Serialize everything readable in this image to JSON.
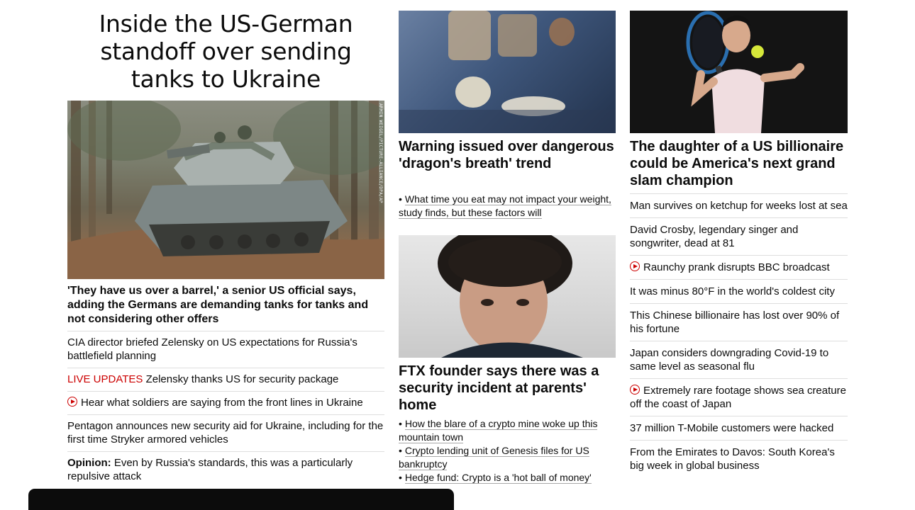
{
  "lead": {
    "headline": "Inside the US-German standoff over sending tanks to Ukraine",
    "image_credit": "ARMIN WEIGEL/PICTURE-ALLIANCE/DPA/AP",
    "subheadline": "'They have us over a barrel,' a senior US official says, adding the Germans are demanding tanks for tanks and not considering other offers",
    "related": [
      {
        "text": "CIA director briefed Zelensky on US expectations for Russia's battlefield planning"
      },
      {
        "label": "LIVE UPDATES",
        "text": "Zelensky thanks US for security package"
      },
      {
        "text": "Hear what soldiers are saying from the front lines in Ukraine",
        "icon": "play-icon"
      },
      {
        "text": "Pentagon announces new security aid for Ukraine, including for the first time Stryker armored vehicles"
      },
      {
        "label": "Opinion:",
        "text": "Even by Russia's standards, this was a particularly repulsive attack"
      }
    ]
  },
  "middle": {
    "card1": {
      "title": "Warning issued over dangerous 'dragon's breath' trend",
      "bullets": [
        "What time you eat may not impact your weight, study finds, but these factors will"
      ]
    },
    "card2": {
      "title": "FTX founder says there was a security incident at parents' home",
      "bullets": [
        "How the blare of a crypto mine woke up this mountain town",
        "Crypto lending unit of Genesis files for US bankruptcy",
        "Hedge fund: Crypto is a 'hot ball of money'"
      ]
    }
  },
  "right": {
    "title": "The daughter of a US billionaire could be America's next grand slam champion",
    "list": [
      {
        "text": "Man survives on ketchup for weeks lost at sea"
      },
      {
        "text": "David Crosby, legendary singer and songwriter, dead at 81"
      },
      {
        "text": "Raunchy prank disrupts BBC broadcast",
        "icon": "play-icon"
      },
      {
        "text": "It was minus 80°F in the world's coldest city"
      },
      {
        "text": "This Chinese billionaire has lost over 90% of his fortune"
      },
      {
        "text": "Japan considers downgrading Covid-19 to same level as seasonal flu"
      },
      {
        "text": "Extremely rare footage shows sea creature off the coast of Japan",
        "icon": "play-icon"
      },
      {
        "text": "37 million T-Mobile customers were hacked"
      },
      {
        "text": "From the Emirates to Davos: South Korea's big week in global business"
      }
    ]
  },
  "colors": {
    "live_red": "#cc0000",
    "text": "#0c0c0c",
    "divider": "#dedede",
    "overlay": "#0c0c0c"
  }
}
